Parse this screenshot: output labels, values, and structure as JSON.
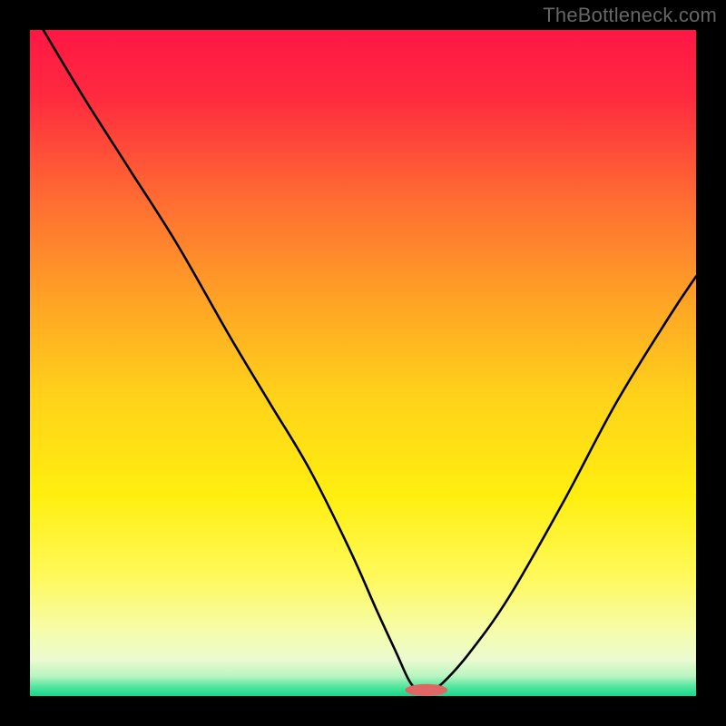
{
  "watermark": "TheBottleneck.com",
  "chart_data": {
    "type": "line",
    "title": "",
    "xlabel": "",
    "ylabel": "",
    "xlim": [
      0,
      100
    ],
    "ylim": [
      0,
      100
    ],
    "gradient_stops": [
      {
        "offset": 0.0,
        "color": "#ff1744"
      },
      {
        "offset": 0.1,
        "color": "#ff2a3f"
      },
      {
        "offset": 0.25,
        "color": "#ff6a33"
      },
      {
        "offset": 0.4,
        "color": "#ffa126"
      },
      {
        "offset": 0.55,
        "color": "#ffd21a"
      },
      {
        "offset": 0.7,
        "color": "#ffef0f"
      },
      {
        "offset": 0.82,
        "color": "#fff95a"
      },
      {
        "offset": 0.9,
        "color": "#f6fca8"
      },
      {
        "offset": 0.945,
        "color": "#ecfbd0"
      },
      {
        "offset": 0.97,
        "color": "#b8f5c0"
      },
      {
        "offset": 0.985,
        "color": "#58e6a0"
      },
      {
        "offset": 1.0,
        "color": "#15d88a"
      }
    ],
    "series": [
      {
        "name": "bottleneck-curve",
        "x": [
          2,
          8,
          15,
          22,
          30,
          36,
          42,
          48,
          52,
          55,
          57,
          58.5,
          60,
          62,
          66,
          72,
          80,
          88,
          96,
          100
        ],
        "y": [
          100,
          90,
          79,
          68,
          54,
          44,
          34,
          22,
          13,
          6.5,
          2.2,
          0.8,
          0.8,
          2.0,
          6.5,
          15,
          29,
          44,
          57,
          63
        ]
      }
    ],
    "flat_segment": {
      "x0": 56.5,
      "x1": 62.5,
      "y": 0.5
    },
    "marker": {
      "x": 59.5,
      "y": 0.9,
      "rx": 3.2,
      "ry": 0.9,
      "color": "#e06666"
    }
  }
}
